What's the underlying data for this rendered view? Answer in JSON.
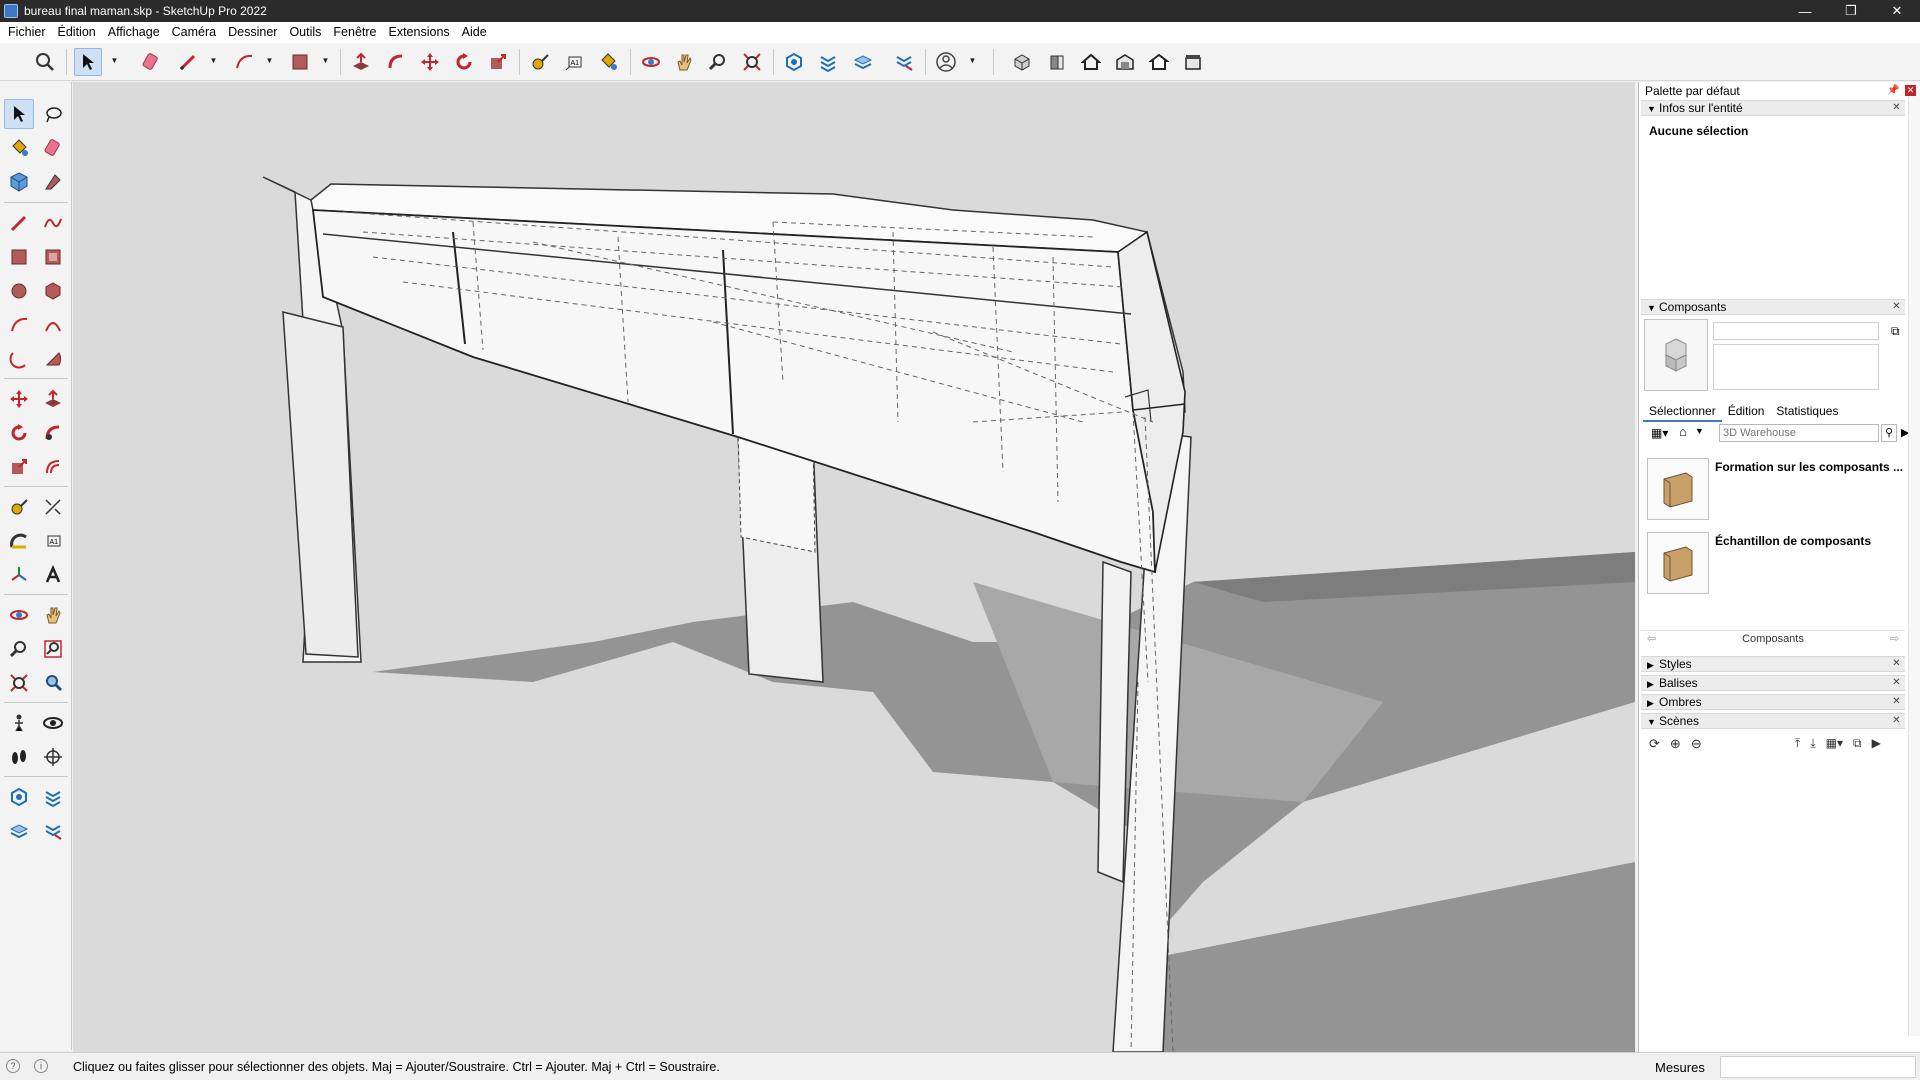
{
  "window": {
    "title": "bureau  final maman.skp - SketchUp Pro 2022",
    "controls": [
      "—",
      "❐",
      "✕"
    ]
  },
  "menu": [
    "Fichier",
    "Édition",
    "Affichage",
    "Caméra",
    "Dessiner",
    "Outils",
    "Fenêtre",
    "Extensions",
    "Aide"
  ],
  "toolbar": {
    "icons": [
      "search-icon",
      "select-icon",
      "eraser-icon",
      "pencil-icon",
      "arc-icon",
      "rectangle-icon",
      "push-pull-icon",
      "follow-me-icon",
      "move-icon",
      "rotate-icon",
      "scale-icon",
      "tape-measure-icon",
      "text-icon",
      "paint-bucket-icon",
      "orbit-icon",
      "pan-icon",
      "zoom-icon",
      "zoom-extents-icon",
      "warehouse-icon",
      "extension-warehouse-icon",
      "layout-icon",
      "extension-manager-icon",
      "user-icon",
      "iso-view-icon",
      "front-view-icon",
      "top-view-icon",
      "right-view-icon",
      "back-view-icon",
      "left-view-icon"
    ]
  },
  "lefttools": {
    "icons": [
      "select-icon",
      "lasso-icon",
      "paint-bucket-icon",
      "eraser-icon",
      "component-icon",
      "tag-icon",
      "pencil-icon",
      "freehand-icon",
      "rectangle-icon",
      "rotated-rect-icon",
      "circle-icon",
      "polygon-icon",
      "arc-icon",
      "two-point-arc-icon",
      "three-point-arc-icon",
      "pie-icon",
      "move-icon",
      "push-pull-icon",
      "rotate-icon",
      "follow-me-icon",
      "scale-icon",
      "offset-icon",
      "tape-measure-icon",
      "dimension-icon",
      "protractor-icon",
      "text-icon",
      "axes-icon",
      "3d-text-icon",
      "orbit-icon",
      "pan-icon",
      "zoom-icon",
      "zoom-window-icon",
      "zoom-extents-icon",
      "previous-view-icon",
      "position-camera-icon",
      "look-around-icon",
      "walk-icon",
      "section-plane-icon",
      "warehouse-icon",
      "extension-icon",
      "layout-icon",
      "share-icon"
    ]
  },
  "panel": {
    "title": "Palette par défaut",
    "entity_info": {
      "header": "Infos sur l'entité",
      "value": "Aucune sélection"
    },
    "components": {
      "header": "Composants",
      "tabs": [
        "Sélectionner",
        "Édition",
        "Statistiques"
      ],
      "search_placeholder": "3D Warehouse",
      "items": [
        {
          "title": "Formation sur les composants ..."
        },
        {
          "title": "Échantillon de composants"
        }
      ],
      "footer": "Composants"
    },
    "sections": [
      "Styles",
      "Balises",
      "Ombres",
      "Scènes"
    ]
  },
  "status": {
    "message": "Cliquez ou faites glisser pour sélectionner des objets. Maj = Ajouter/Soustraire. Ctrl = Ajouter. Maj + Ctrl = Soustraire.",
    "measurements_label": "Mesures",
    "measurements_value": ""
  },
  "colors": {
    "viewport_bg": "#dadada",
    "shadow": "#888888",
    "accent": "#3b79c4"
  }
}
